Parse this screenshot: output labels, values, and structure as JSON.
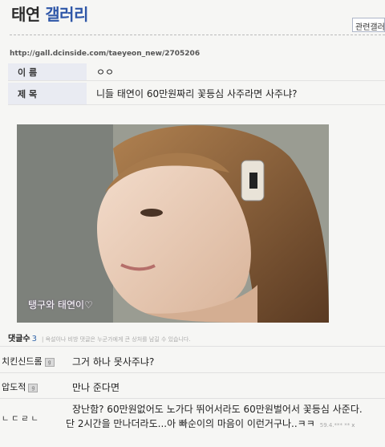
{
  "header": {
    "title_part1": "태연",
    "title_part2": "갤러리",
    "related_label": "관련갤러리"
  },
  "post": {
    "url": "http://gall.dcinside.com/taeyeon_new/2705206",
    "name_label": "이 름",
    "name_value": "ㅇㅇ",
    "subject_label": "제 목",
    "subject_value": "니들 태연이 60만원짜리 꽃등심 사주라면 사주냐?",
    "photo_caption": "탱구와 태연이♡"
  },
  "comments_header": {
    "label": "댓글수",
    "count": "3",
    "note": "| 욕설이나 비방 댓글은 누군가에게 큰 상처를 남길 수 있습니다."
  },
  "comments": [
    {
      "nick": "치킨신드롬",
      "badge": "g",
      "text": "그거 하나 못사주냐?"
    },
    {
      "nick": "압도적",
      "badge": "g",
      "text": "만나 준다면"
    },
    {
      "nick": "ㄴㄷㄹㄴ",
      "text1": "장난함? 60만원없어도 노가다 뛰어서라도 60만원벌어서 꽃등심 사준다.",
      "text2": "단 2시간을 만나더라도...아 빠순이의 마음이 이런거구나..ㅋㅋ",
      "stamp": "59.4.*** **",
      "close": "x"
    }
  ]
}
